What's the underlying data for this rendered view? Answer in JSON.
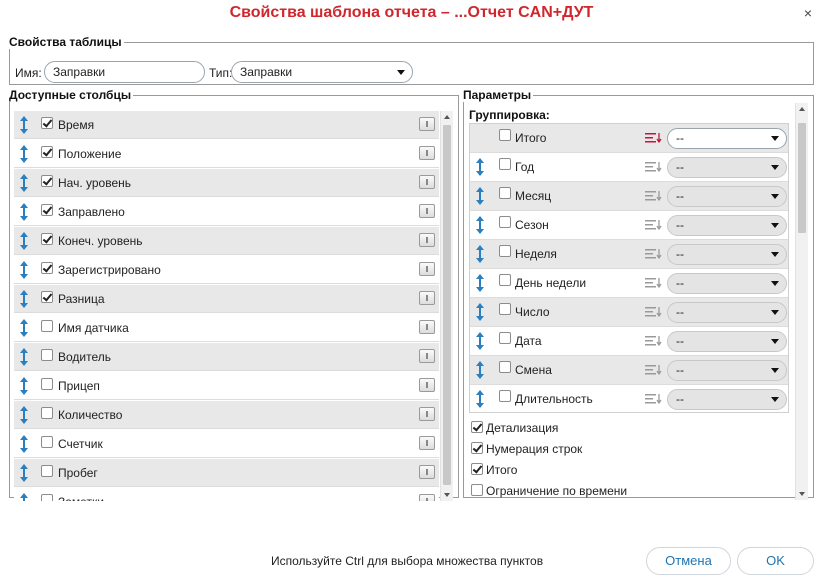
{
  "dialog": {
    "title": "Свойства шаблона отчета – ...Отчет CAN+ДУТ",
    "close_glyph": "×"
  },
  "table_props": {
    "legend": "Свойства таблицы",
    "name_label": "Имя:",
    "name_value": "Заправки",
    "type_label": "Тип:",
    "type_value": "Заправки"
  },
  "columns": {
    "legend": "Доступные столбцы",
    "items": [
      {
        "label": "Время",
        "checked": true
      },
      {
        "label": "Положение",
        "checked": true
      },
      {
        "label": "Нач. уровень",
        "checked": true
      },
      {
        "label": "Заправлено",
        "checked": true
      },
      {
        "label": "Конеч. уровень",
        "checked": true
      },
      {
        "label": "Зарегистрировано",
        "checked": true
      },
      {
        "label": "Разница",
        "checked": true
      },
      {
        "label": "Имя датчика",
        "checked": false
      },
      {
        "label": "Водитель",
        "checked": false
      },
      {
        "label": "Прицеп",
        "checked": false
      },
      {
        "label": "Количество",
        "checked": false
      },
      {
        "label": "Счетчик",
        "checked": false
      },
      {
        "label": "Пробег",
        "checked": false
      },
      {
        "label": "Заметки",
        "checked": false
      }
    ]
  },
  "params": {
    "legend": "Параметры",
    "grouping_label": "Группировка:",
    "grouping": [
      {
        "label": "Итого",
        "value": "--",
        "draggable": false,
        "active": true
      },
      {
        "label": "Год",
        "value": "--",
        "draggable": true,
        "active": false
      },
      {
        "label": "Месяц",
        "value": "--",
        "draggable": true,
        "active": false
      },
      {
        "label": "Сезон",
        "value": "--",
        "draggable": true,
        "active": false
      },
      {
        "label": "Неделя",
        "value": "--",
        "draggable": true,
        "active": false
      },
      {
        "label": "День недели",
        "value": "--",
        "draggable": true,
        "active": false
      },
      {
        "label": "Число",
        "value": "--",
        "draggable": true,
        "active": false
      },
      {
        "label": "Дата",
        "value": "--",
        "draggable": true,
        "active": false
      },
      {
        "label": "Смена",
        "value": "--",
        "draggable": true,
        "active": false
      },
      {
        "label": "Длительность",
        "value": "--",
        "draggable": true,
        "active": false
      }
    ],
    "options": [
      {
        "label": "Детализация",
        "checked": true
      },
      {
        "label": "Нумерация строк",
        "checked": true
      },
      {
        "label": "Итого",
        "checked": true
      },
      {
        "label": "Ограничение по времени",
        "checked": false
      }
    ]
  },
  "footer": {
    "hint": "Используйте Ctrl для выбора множества пунктов",
    "cancel": "Отмена",
    "ok": "OK"
  },
  "colors": {
    "title": "#d0262d",
    "accent": "#1f74b3",
    "drag_icon": "#2a7fc0",
    "sort_active": "#c8143c"
  },
  "icons": {
    "drag": "drag-handle-icon",
    "info": "column-settings-icon",
    "sort": "sort-icon",
    "dropdown": "chevron-down-icon",
    "close": "close-icon"
  }
}
